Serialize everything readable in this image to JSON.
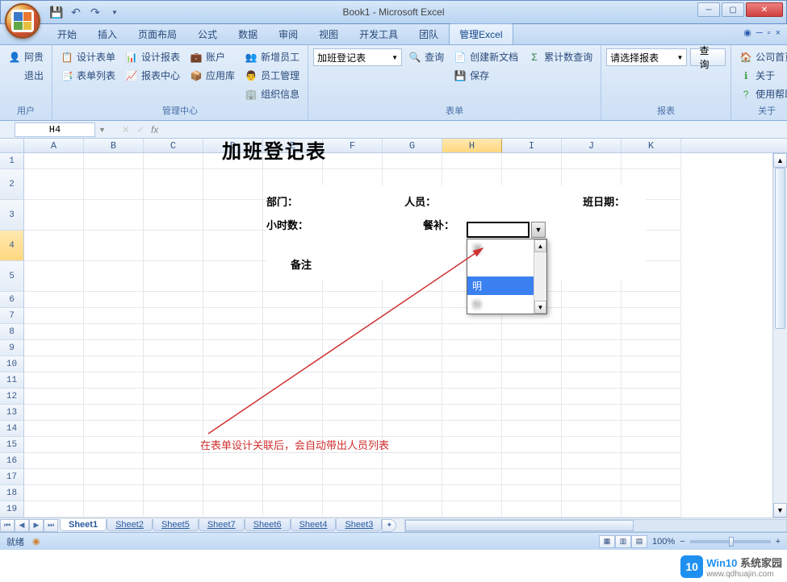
{
  "title": "Book1 - Microsoft Excel",
  "tabs": [
    "开始",
    "插入",
    "页面布局",
    "公式",
    "数据",
    "审阅",
    "视图",
    "开发工具",
    "团队",
    "管理Excel"
  ],
  "active_tab": 9,
  "ribbon": {
    "groups": [
      {
        "label": "用户",
        "cols": [
          [
            {
              "icon": "👤",
              "cls": "ico-user",
              "text": "阿贵"
            },
            {
              "icon": "",
              "text": "退出"
            }
          ]
        ]
      },
      {
        "label": "管理中心",
        "cols": [
          [
            {
              "icon": "📋",
              "cls": "ico-form",
              "text": "设计表单"
            },
            {
              "icon": "📑",
              "cls": "ico-form",
              "text": "表单列表"
            }
          ],
          [
            {
              "icon": "📊",
              "cls": "ico-report",
              "text": "设计报表"
            },
            {
              "icon": "📈",
              "cls": "ico-report",
              "text": "报表中心"
            }
          ],
          [
            {
              "icon": "💼",
              "cls": "ico-account",
              "text": "账户"
            },
            {
              "icon": "📦",
              "cls": "ico-form",
              "text": "应用库"
            }
          ],
          [
            {
              "icon": "👥",
              "cls": "ico-emp",
              "text": "新增员工"
            },
            {
              "icon": "👨",
              "cls": "ico-emp",
              "text": "员工管理"
            },
            {
              "icon": "🏢",
              "cls": "ico-org",
              "text": "组织信息"
            }
          ]
        ]
      },
      {
        "label": "表单",
        "select": "加班登记表",
        "cols": [
          [
            {
              "icon": "🔍",
              "text": "查询"
            }
          ],
          [
            {
              "icon": "📄",
              "cls": "ico-doc",
              "text": "创建新文档"
            },
            {
              "icon": "💾",
              "text": "保存"
            }
          ],
          [
            {
              "icon": "Σ",
              "cls": "ico-sum",
              "text": "累计数查询"
            }
          ]
        ]
      },
      {
        "label": "报表",
        "select": "请选择报表",
        "button": "查询"
      },
      {
        "label": "关于",
        "cols": [
          [
            {
              "icon": "🏠",
              "cls": "ico-home",
              "text": "公司首页"
            },
            {
              "icon": "ℹ",
              "cls": "ico-about",
              "text": "关于"
            },
            {
              "icon": "?",
              "cls": "ico-help",
              "text": "使用帮助"
            }
          ]
        ]
      }
    ]
  },
  "name_box": "H4",
  "columns": [
    "A",
    "B",
    "C",
    "D",
    "E",
    "F",
    "G",
    "H",
    "I",
    "J",
    "K"
  ],
  "selected_col": 7,
  "rows": 23,
  "selected_row": 4,
  "tall_rows": [
    2,
    3,
    4,
    5
  ],
  "form": {
    "title": "加班登记表",
    "labels": {
      "dept": "部门：",
      "person": "人员：",
      "date": "班日期：",
      "hours": "小时数：",
      "meal": "餐补：",
      "note": "备注"
    },
    "dropdown_items": [
      "波",
      "",
      "明",
      "份"
    ],
    "dropdown_highlight": 2
  },
  "annotation": "在表单设计关联后，会自动带出人员列表",
  "sheets": [
    "Sheet1",
    "Sheet2",
    "Sheet5",
    "Sheet7",
    "Sheet6",
    "Sheet4",
    "Sheet3"
  ],
  "active_sheet": 0,
  "status": "就绪",
  "zoom": "100%",
  "watermark": {
    "badge": "10",
    "line1": "Win10",
    "line2": "www.qdhuajin.com"
  }
}
